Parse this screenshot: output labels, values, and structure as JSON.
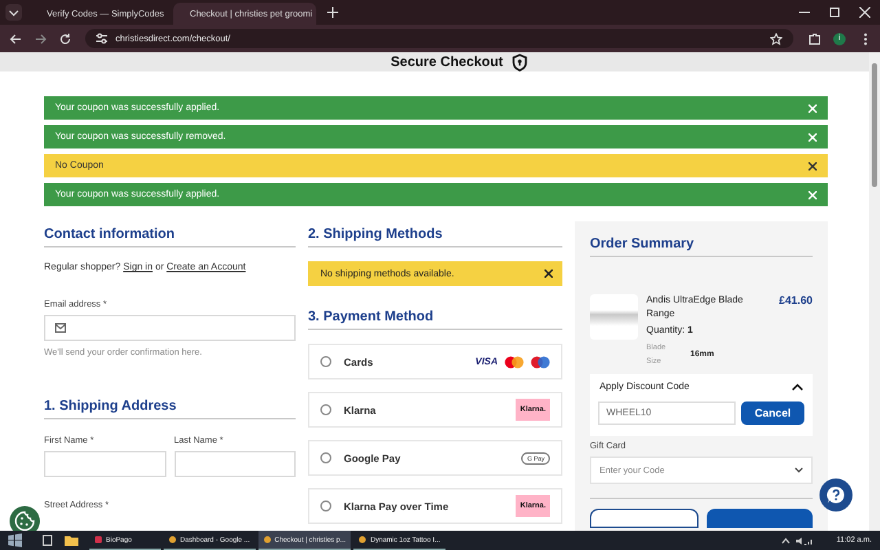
{
  "browser": {
    "tabs": [
      {
        "title": "Verify Codes — SimplyCodes",
        "selected": false
      },
      {
        "title": "Checkout | christies pet groomi",
        "selected": true
      }
    ],
    "url": "christiesdirect.com/checkout/",
    "profile_initial": "i"
  },
  "header": {
    "title": "Secure Checkout"
  },
  "alerts": [
    {
      "kind": "success",
      "text": "Your coupon was successfully applied."
    },
    {
      "kind": "success",
      "text": "Your coupon was successfully removed."
    },
    {
      "kind": "warning",
      "text": "No Coupon"
    },
    {
      "kind": "success",
      "text": "Your coupon was successfully applied."
    }
  ],
  "contact": {
    "heading": "Contact information",
    "prompt": "Regular shopper?",
    "sign_in": "Sign in",
    "or": "or",
    "create_account": "Create an Account",
    "email_label": "Email address *",
    "email_hint": "We'll send your order confirmation here."
  },
  "shipping_address": {
    "heading": "1. Shipping Address",
    "first_name_label": "First Name *",
    "last_name_label": "Last Name *",
    "street_label": "Street Address *"
  },
  "shipping_methods": {
    "heading": "2. Shipping Methods",
    "notice": "No shipping methods available."
  },
  "payment": {
    "heading": "3. Payment Method",
    "methods": [
      {
        "name": "Cards",
        "kind": "cards",
        "badge": "VISA",
        "selected": false
      },
      {
        "name": "Klarna",
        "kind": "bnpl",
        "badge": "Klarna.",
        "selected": false
      },
      {
        "name": "Google Pay",
        "kind": "wallet",
        "badge": "G Pay",
        "selected": false
      },
      {
        "name": "Klarna Pay over Time",
        "kind": "bnpl",
        "badge": "Klarna.",
        "selected": false
      }
    ]
  },
  "summary": {
    "heading": "Order Summary",
    "item": {
      "name": "Andis UltraEdge Blade Range",
      "price": "£41.60",
      "quantity_label": "Quantity:",
      "quantity": "1",
      "option_label": "Blade Size",
      "option_value": "16mm"
    },
    "discount": {
      "title": "Apply Discount Code",
      "expanded": true,
      "value": "WHEEL10",
      "button": "Cancel"
    },
    "gift_card": {
      "label": "Gift Card",
      "placeholder": "Enter your Code"
    }
  },
  "taskbar": {
    "apps": [
      {
        "title": "BioPago",
        "selected": false
      },
      {
        "title": "Dashboard - Google ...",
        "selected": false
      },
      {
        "title": "Checkout | christies p...",
        "selected": true
      },
      {
        "title": "Dynamic 1oz Tattoo I...",
        "selected": false
      }
    ],
    "time": "11:02 a.m."
  }
}
